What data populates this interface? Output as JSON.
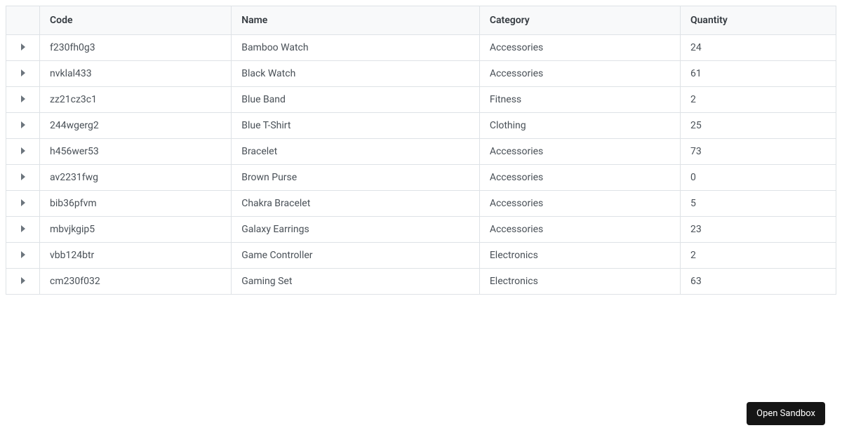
{
  "table": {
    "headers": {
      "code": "Code",
      "name": "Name",
      "category": "Category",
      "quantity": "Quantity"
    },
    "rows": [
      {
        "code": "f230fh0g3",
        "name": "Bamboo Watch",
        "category": "Accessories",
        "quantity": "24"
      },
      {
        "code": "nvklal433",
        "name": "Black Watch",
        "category": "Accessories",
        "quantity": "61"
      },
      {
        "code": "zz21cz3c1",
        "name": "Blue Band",
        "category": "Fitness",
        "quantity": "2"
      },
      {
        "code": "244wgerg2",
        "name": "Blue T-Shirt",
        "category": "Clothing",
        "quantity": "25"
      },
      {
        "code": "h456wer53",
        "name": "Bracelet",
        "category": "Accessories",
        "quantity": "73"
      },
      {
        "code": "av2231fwg",
        "name": "Brown Purse",
        "category": "Accessories",
        "quantity": "0"
      },
      {
        "code": "bib36pfvm",
        "name": "Chakra Bracelet",
        "category": "Accessories",
        "quantity": "5"
      },
      {
        "code": "mbvjkgip5",
        "name": "Galaxy Earrings",
        "category": "Accessories",
        "quantity": "23"
      },
      {
        "code": "vbb124btr",
        "name": "Game Controller",
        "category": "Electronics",
        "quantity": "2"
      },
      {
        "code": "cm230f032",
        "name": "Gaming Set",
        "category": "Electronics",
        "quantity": "63"
      }
    ]
  },
  "sandbox": {
    "label": "Open Sandbox"
  }
}
